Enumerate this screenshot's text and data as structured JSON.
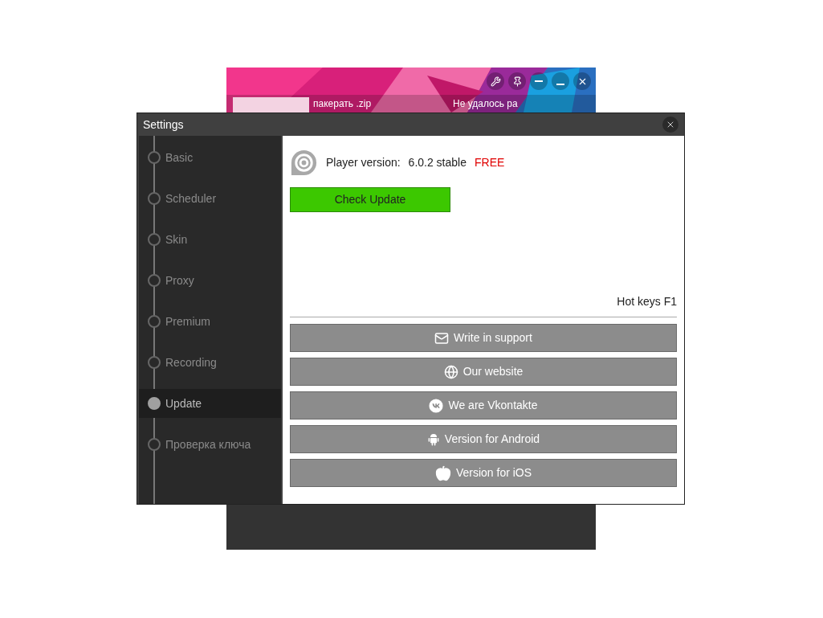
{
  "background_window": {
    "kind": "picture",
    "status_texts": [
      "пакерать .zip",
      "Не удалось ра"
    ]
  },
  "window": {
    "title": "Settings"
  },
  "sidebar": {
    "items": [
      {
        "label": "Basic",
        "selected": false
      },
      {
        "label": "Scheduler",
        "selected": false
      },
      {
        "label": "Skin",
        "selected": false
      },
      {
        "label": "Proxy",
        "selected": false
      },
      {
        "label": "Premium",
        "selected": false
      },
      {
        "label": "Recording",
        "selected": false
      },
      {
        "label": "Update",
        "selected": true
      },
      {
        "label": "Проверка ключа",
        "selected": false
      }
    ]
  },
  "version": {
    "label": "Player version:",
    "value": "6.0.2 stable",
    "edition": "FREE"
  },
  "check_update": "Check Update",
  "hotkeys": "Hot keys F1",
  "links": [
    {
      "kind": "mail",
      "label": "Write in support"
    },
    {
      "kind": "globe",
      "label": "Our website"
    },
    {
      "kind": "vk",
      "label": "We are Vkontakte"
    },
    {
      "kind": "android",
      "label": "Version for Android"
    },
    {
      "kind": "apple",
      "label": "Version for iOS"
    }
  ]
}
